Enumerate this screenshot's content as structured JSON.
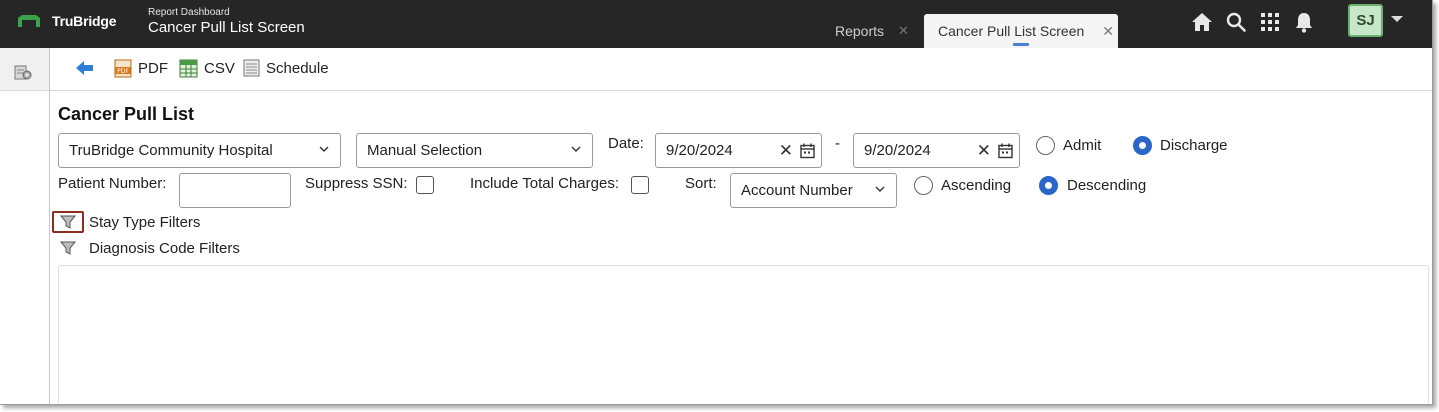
{
  "brand": {
    "name": "TruBridge",
    "accent": "#3aa34a"
  },
  "breadcrumb": {
    "section": "Report Dashboard",
    "title": "Cancer Pull List Screen"
  },
  "tabs": [
    {
      "label": "Reports",
      "active": false
    },
    {
      "label": "Cancer Pull List Screen",
      "active": true
    }
  ],
  "header_icons": [
    "home-icon",
    "search-icon",
    "apps-grid-icon",
    "bell-icon"
  ],
  "user": {
    "initials": "SJ"
  },
  "toolbar": {
    "pdf_label": "PDF",
    "csv_label": "CSV",
    "schedule_label": "Schedule"
  },
  "page": {
    "title": "Cancer Pull List"
  },
  "form": {
    "facility": "TruBridge Community Hospital",
    "selection_mode": "Manual Selection",
    "date_label": "Date:",
    "date_from": "9/20/2024",
    "date_separator": "-",
    "date_to": "9/20/2024",
    "date_type_options": [
      {
        "label": "Admit",
        "selected": false
      },
      {
        "label": "Discharge",
        "selected": true
      }
    ],
    "patient_number_label": "Patient Number:",
    "patient_number_value": "",
    "suppress_ssn_label": "Suppress SSN:",
    "suppress_ssn_checked": false,
    "include_total_charges_label": "Include Total Charges:",
    "include_total_charges_checked": false,
    "sort_label": "Sort:",
    "sort_value": "Account Number",
    "sort_order_options": [
      {
        "label": "Ascending",
        "selected": false
      },
      {
        "label": "Descending",
        "selected": true
      }
    ]
  },
  "filters": [
    {
      "label": "Stay Type Filters",
      "focused": true
    },
    {
      "label": "Diagnosis Code Filters",
      "focused": false
    }
  ]
}
